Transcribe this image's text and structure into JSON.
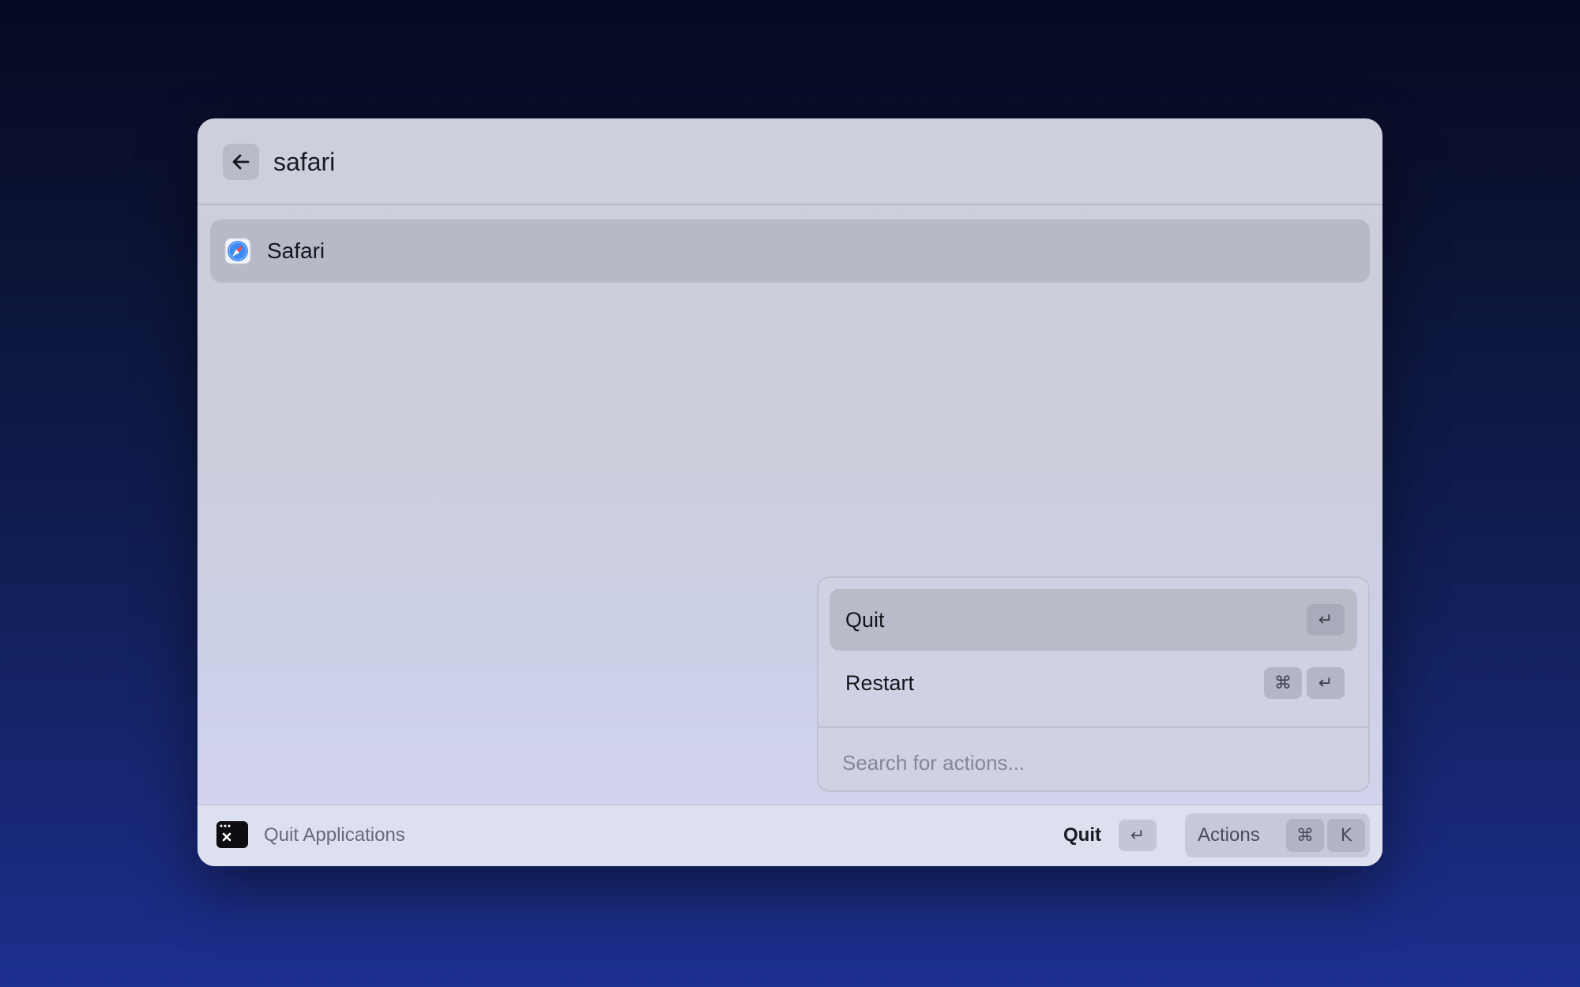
{
  "header": {
    "back_icon": "arrow-left-icon",
    "query": "safari"
  },
  "results": [
    {
      "label": "Safari",
      "icon": "safari-compass-icon"
    }
  ],
  "actions_panel": {
    "items": [
      {
        "label": "Quit",
        "keys": [
          "↵"
        ],
        "selected": true
      },
      {
        "label": "Restart",
        "keys": [
          "⌘",
          "↵"
        ],
        "selected": false
      }
    ],
    "search_placeholder": "Search for actions..."
  },
  "footer": {
    "extension_icon": "terminal-close-icon",
    "extension_name": "Quit Applications",
    "primary_action": {
      "label": "Quit",
      "key": "↵"
    },
    "actions_button": {
      "label": "Actions",
      "keys": [
        "⌘",
        "K"
      ]
    }
  },
  "colors": {
    "window_bg": "#cdcfdc",
    "selection": "#b7b9c7",
    "footer_bg": "#dde1ef"
  }
}
